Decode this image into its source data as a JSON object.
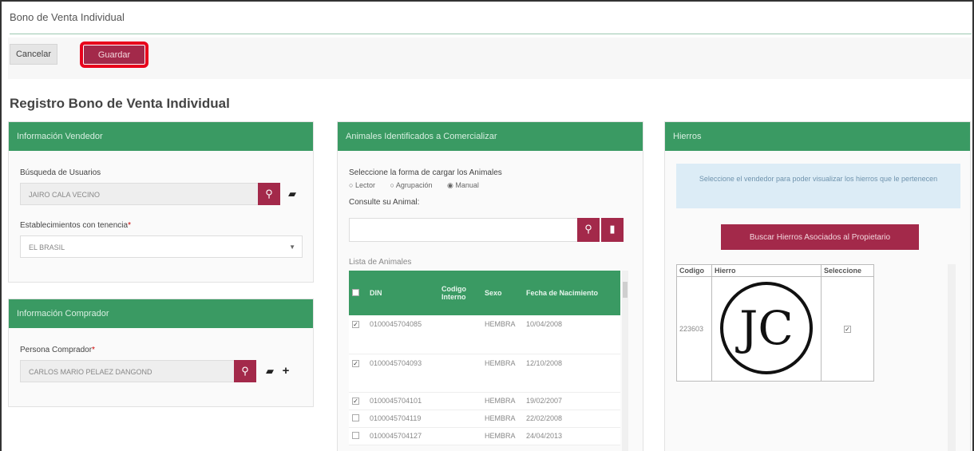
{
  "page": {
    "title": "Bono de Venta Individual"
  },
  "toolbar": {
    "cancel_label": "Cancelar",
    "save_label": "Guardar"
  },
  "section_title": "Registro Bono de Venta Individual",
  "vendedor": {
    "header": "Información Vendedor",
    "search_label": "Búsqueda de Usuarios",
    "search_value": "JAIRO CALA VECINO",
    "establecimientos_label": "Establecimientos con tenencia",
    "establecimientos_value": "EL BRASIL"
  },
  "comprador": {
    "header": "Información Comprador",
    "persona_label": "Persona Comprador",
    "persona_value": "CARLOS MARIO PELAEZ DANGOND"
  },
  "animales": {
    "header": "Animales Identificados a Comercializar",
    "load_label": "Seleccione la forma de cargar los Animales",
    "options": [
      "Lector",
      "Agrupación",
      "Manual"
    ],
    "selected_option": "Manual",
    "consulte_label": "Consulte su Animal:",
    "list_label": "Lista de Animales",
    "columns": [
      "DIN",
      "Codigo Interno",
      "Sexo",
      "Fecha de Nacimiento"
    ],
    "rows": [
      {
        "checked": true,
        "din": "0100045704085",
        "codigo": "",
        "sexo": "HEMBRA",
        "fecha": "10/04/2008"
      },
      {
        "checked": true,
        "din": "0100045704093",
        "codigo": "",
        "sexo": "HEMBRA",
        "fecha": "12/10/2008"
      },
      {
        "checked": true,
        "din": "0100045704101",
        "codigo": "",
        "sexo": "HEMBRA",
        "fecha": "19/02/2007"
      },
      {
        "checked": false,
        "din": "0100045704119",
        "codigo": "",
        "sexo": "HEMBRA",
        "fecha": "22/02/2008"
      },
      {
        "checked": false,
        "din": "0100045704127",
        "codigo": "",
        "sexo": "HEMBRA",
        "fecha": "24/04/2013"
      }
    ]
  },
  "hierros": {
    "header": "Hierros",
    "info_text": "Seleccione el vendedor para poder visualizar los hierros que le pertenecen",
    "button_label": "Buscar Hierros Asociados al Propietario",
    "columns": [
      "Codigo",
      "Hierro",
      "Seleccione"
    ],
    "row": {
      "codigo": "223603",
      "hierro_mark": "JC",
      "selected": true
    }
  },
  "icons": {
    "search": "search-icon",
    "eraser": "eraser-icon",
    "plus": "plus-icon",
    "folder": "folder-icon",
    "caret": "caret-down-icon"
  },
  "colors": {
    "brand_green": "#3a9a63",
    "brand_maroon": "#a3294a",
    "highlight_red": "#e8001c"
  }
}
